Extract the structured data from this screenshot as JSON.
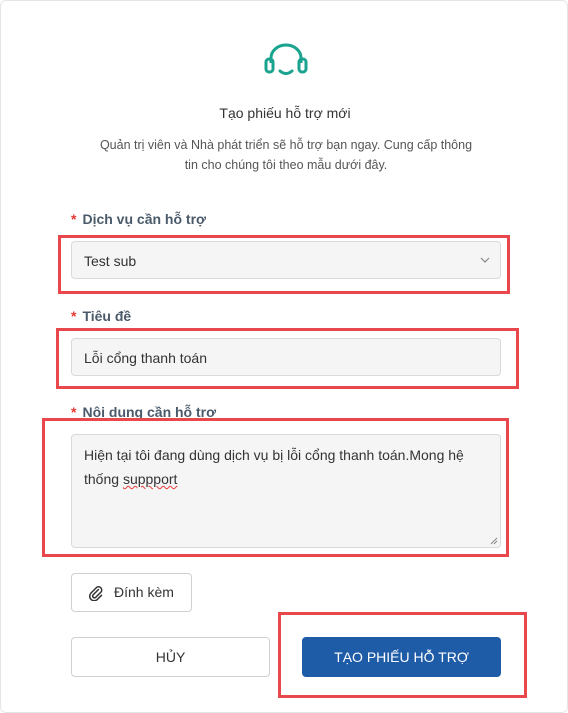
{
  "header": {
    "title": "Tạo phiếu hỗ trợ mới",
    "subtitle": "Quản trị viên và Nhà phát triển sẽ hỗ trợ bạn ngay. Cung cấp thông tin cho chúng tôi theo mẫu dưới đây."
  },
  "form": {
    "required_mark": "*",
    "service": {
      "label": "Dịch vụ cần hỗ trợ",
      "value": "Test sub"
    },
    "subject": {
      "label": "Tiêu đề",
      "value": "Lỗi cổng thanh toán"
    },
    "content": {
      "label": "Nội dung cần hỗ trợ",
      "value_main": "Hiện tại tôi đang dùng dịch vụ bị lỗi cổng thanh toán.Mong hệ thống ",
      "value_misspelled": "suppport"
    },
    "attach_label": "Đính kèm"
  },
  "actions": {
    "cancel_label": "HỦY",
    "submit_label": "TẠO PHIẾU HỖ TRỢ"
  },
  "colors": {
    "accent": "#1f5ca8",
    "logo": "#1aa38f",
    "highlight": "#e8474b",
    "required": "#e53935"
  },
  "icons": [
    "headset-icon",
    "chevron-down-icon",
    "paperclip-icon",
    "resize-grip-icon"
  ]
}
